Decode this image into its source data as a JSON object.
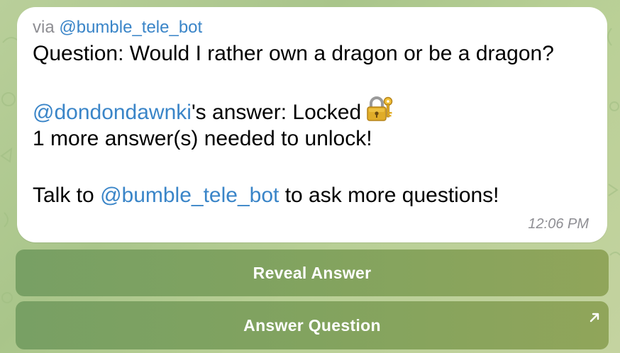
{
  "bubble": {
    "via_prefix": "via",
    "via_bot": "@bumble_tele_bot",
    "question_line": "Question: Would I rather own a dragon or be a dragon?",
    "answer_user": "@dondondawnki",
    "answer_suffix": "'s answer: Locked",
    "lock_icon": "lock-with-key-icon",
    "unlock_line": "1 more answer(s) needed to unlock!",
    "talk_prefix": "Talk to",
    "talk_bot": "@bumble_tele_bot",
    "talk_suffix": "to ask more questions!",
    "time": "12:06 PM"
  },
  "buttons": {
    "reveal": "Reveal Answer",
    "answer": "Answer Question",
    "answer_icon": "external-arrow-icon"
  },
  "colors": {
    "link": "#3a85c8",
    "button": "#82a35f",
    "bubble": "#ffffff",
    "meta_text": "#8e8e93"
  }
}
